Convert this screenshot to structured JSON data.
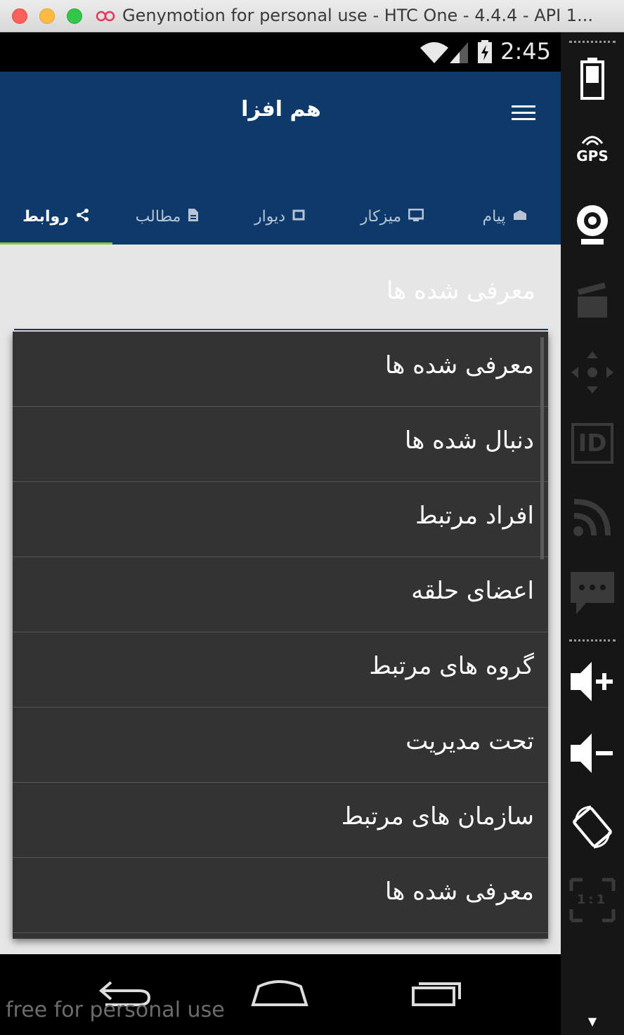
{
  "window": {
    "title": "Genymotion for personal use - HTC One - 4.4.4 - API 1..."
  },
  "statusbar": {
    "time": "2:45",
    "icons": [
      "wifi-icon",
      "signal-icon",
      "battery-charging-icon"
    ]
  },
  "appbar": {
    "title": "هم افزا",
    "menu_icon": "hamburger-menu-icon"
  },
  "tabs": [
    {
      "label": "پیام",
      "icon": "envelope-open-icon",
      "active": false
    },
    {
      "label": "میزکار",
      "icon": "monitor-icon",
      "active": false
    },
    {
      "label": "دیوار",
      "icon": "frame-icon",
      "active": false
    },
    {
      "label": "مطالب",
      "icon": "document-icon",
      "active": false
    },
    {
      "label": "روابط",
      "icon": "share-icon",
      "active": true
    }
  ],
  "colors": {
    "appbar": "#0e3a6b",
    "tab_indicator": "#8bc34a",
    "dropdown_bg": "#333333",
    "content_bg": "#e6e6e6"
  },
  "spinner": {
    "selected": "معرفی شده ها"
  },
  "dropdown": {
    "items": [
      "معرفی شده ها",
      "دنبال شده ها",
      "افراد مرتبط",
      "اعضای حلقه",
      "گروه های مرتبط",
      "تحت مدیریت",
      "سازمان های مرتبط",
      "معرفی شده ها"
    ]
  },
  "navbar": {
    "buttons": [
      "back-icon",
      "home-icon",
      "recent-apps-icon"
    ]
  },
  "watermark": "free for personal use",
  "sidepanel": {
    "gps_label": "GPS",
    "id_label": "ID",
    "ratio_label": "1:1",
    "icons": [
      "battery-icon",
      "gps-icon",
      "webcam-icon",
      "clapperboard-icon",
      "dpad-icon",
      "id-icon",
      "rss-icon",
      "sms-icon",
      "volume-up-icon",
      "volume-down-icon",
      "rotate-icon",
      "scale-icon"
    ]
  }
}
